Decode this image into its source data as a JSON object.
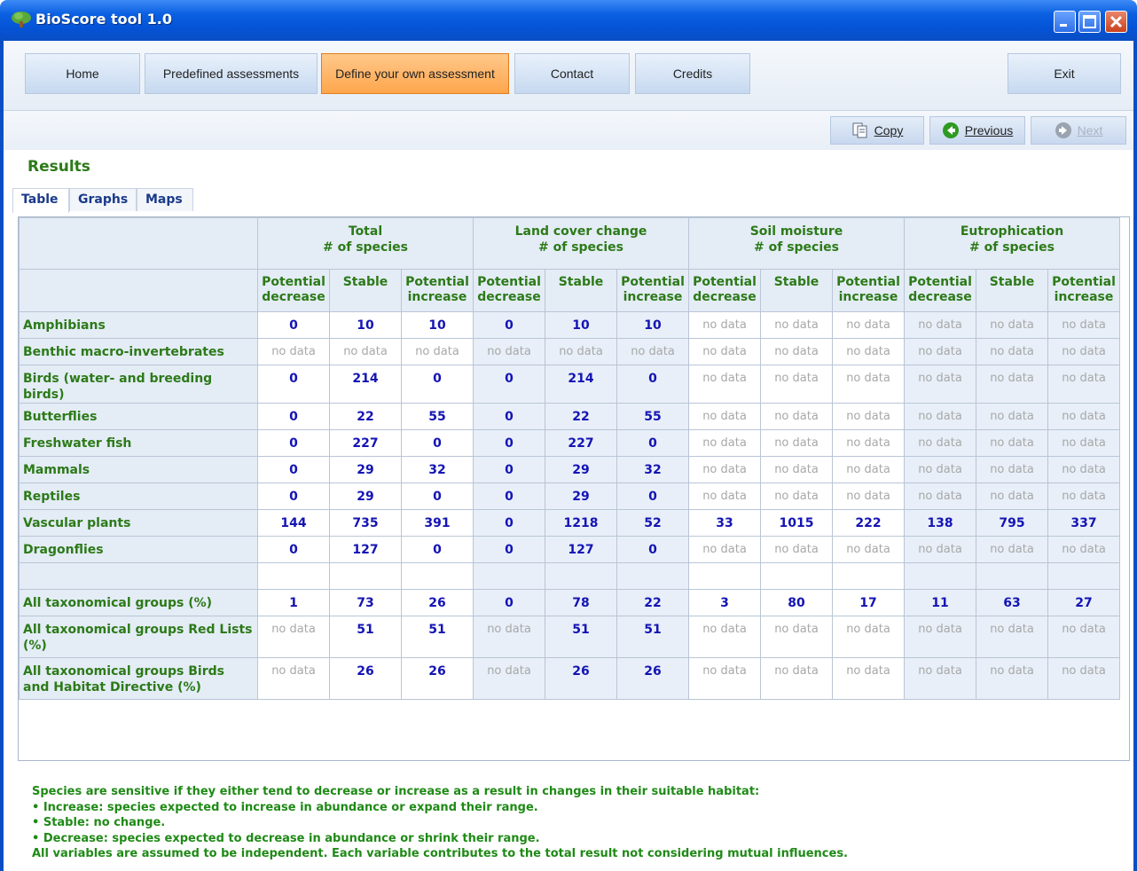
{
  "window": {
    "title": "BioScore tool  1.0"
  },
  "nav": {
    "home": "Home",
    "predefined": "Predefined assessments",
    "define": "Define your own assessment",
    "contact": "Contact",
    "credits": "Credits",
    "exit": "Exit"
  },
  "toolbar": {
    "copy": "Copy",
    "previous": "Previous",
    "next": "Next"
  },
  "results_title": "Results",
  "tabs": {
    "table": "Table",
    "graphs": "Graphs",
    "maps": "Maps"
  },
  "table": {
    "groups": [
      {
        "line1": "Total",
        "line2": "# of species"
      },
      {
        "line1": "Land cover change",
        "line2": "# of species"
      },
      {
        "line1": "Soil moisture",
        "line2": "# of species"
      },
      {
        "line1": "Eutrophication",
        "line2": "# of species"
      }
    ],
    "subheaders": {
      "decrease1": "Potential",
      "decrease2": "decrease",
      "stable": "Stable",
      "increase1": "Potential",
      "increase2": "increase"
    },
    "rows": [
      {
        "label": "Amphibians",
        "values": [
          "0",
          "10",
          "10",
          "0",
          "10",
          "10",
          "no data",
          "no data",
          "no data",
          "no data",
          "no data",
          "no data"
        ]
      },
      {
        "label": "Benthic macro-invertebrates",
        "values": [
          "no data",
          "no data",
          "no data",
          "no data",
          "no data",
          "no data",
          "no data",
          "no data",
          "no data",
          "no data",
          "no data",
          "no data"
        ]
      },
      {
        "label": "Birds (water- and breeding birds)",
        "values": [
          "0",
          "214",
          "0",
          "0",
          "214",
          "0",
          "no data",
          "no data",
          "no data",
          "no data",
          "no data",
          "no data"
        ]
      },
      {
        "label": "Butterflies",
        "values": [
          "0",
          "22",
          "55",
          "0",
          "22",
          "55",
          "no data",
          "no data",
          "no data",
          "no data",
          "no data",
          "no data"
        ]
      },
      {
        "label": "Freshwater fish",
        "values": [
          "0",
          "227",
          "0",
          "0",
          "227",
          "0",
          "no data",
          "no data",
          "no data",
          "no data",
          "no data",
          "no data"
        ]
      },
      {
        "label": "Mammals",
        "values": [
          "0",
          "29",
          "32",
          "0",
          "29",
          "32",
          "no data",
          "no data",
          "no data",
          "no data",
          "no data",
          "no data"
        ]
      },
      {
        "label": "Reptiles",
        "values": [
          "0",
          "29",
          "0",
          "0",
          "29",
          "0",
          "no data",
          "no data",
          "no data",
          "no data",
          "no data",
          "no data"
        ]
      },
      {
        "label": "Vascular plants",
        "values": [
          "144",
          "735",
          "391",
          "0",
          "1218",
          "52",
          "33",
          "1015",
          "222",
          "138",
          "795",
          "337"
        ]
      },
      {
        "label": "Dragonflies",
        "values": [
          "0",
          "127",
          "0",
          "0",
          "127",
          "0",
          "no data",
          "no data",
          "no data",
          "no data",
          "no data",
          "no data"
        ]
      },
      {
        "label": "",
        "values": [
          "",
          "",
          "",
          "",
          "",
          "",
          "",
          "",
          "",
          "",
          "",
          ""
        ]
      },
      {
        "label": "All taxonomical groups (%)",
        "values": [
          "1",
          "73",
          "26",
          "0",
          "78",
          "22",
          "3",
          "80",
          "17",
          "11",
          "63",
          "27"
        ]
      },
      {
        "label": "All taxonomical groups Red Lists (%)",
        "values": [
          "no data",
          "51",
          "51",
          "no data",
          "51",
          "51",
          "no data",
          "no data",
          "no data",
          "no data",
          "no data",
          "no data"
        ]
      },
      {
        "label": "All taxonomical groups Birds and Habitat Directive (%)",
        "values": [
          "no data",
          "26",
          "26",
          "no data",
          "26",
          "26",
          "no data",
          "no data",
          "no data",
          "no data",
          "no data",
          "no data"
        ]
      }
    ]
  },
  "footnote": {
    "line1": "Species are sensitive if they either tend to decrease or increase as a result in changes in their suitable habitat:",
    "line2": "• Increase: species expected to increase in abundance or expand their range.",
    "line3": "• Stable: no change.",
    "line4": "• Decrease: species expected to decrease in abundance or shrink their range.",
    "line5": "All variables are assumed to be independent. Each variable contributes to the total result not considering mutual influences."
  },
  "colors": {
    "accent_green": "#2c7a18",
    "value_blue": "#1414b4",
    "active_tab_orange": "#ffa64d",
    "titlebar_blue": "#0553d6"
  },
  "icons": {
    "app": "tree-icon",
    "copy": "copy-icon",
    "previous": "arrow-left-icon",
    "next": "arrow-right-icon"
  }
}
